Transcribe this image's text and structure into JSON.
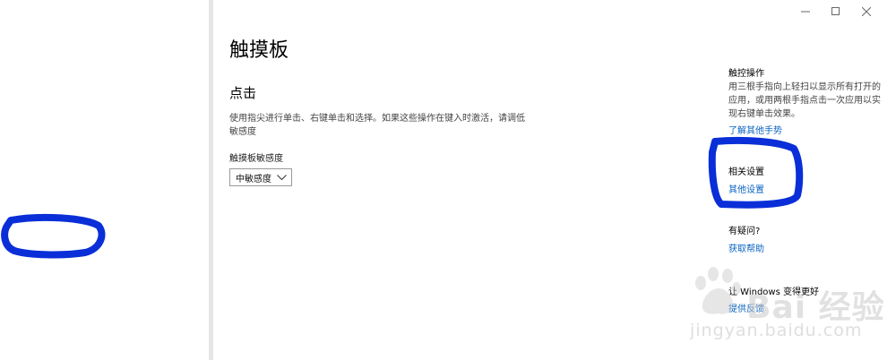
{
  "window": {
    "minimize_glyph": "—",
    "maximize_glyph": "☐",
    "close_glyph": "✕"
  },
  "page": {
    "title": "触摸板"
  },
  "tap_section": {
    "title": "点击",
    "description": "使用指尖进行单击、右键单击和选择。如果这些操作在键入时激活，请调低敏感度",
    "sensitivity_label": "触摸板敏感度",
    "sensitivity_value": "中敏感度"
  },
  "sidebar": {
    "gestures_heading": "触控操作",
    "gestures_text": "用三根手指向上轻扫以显示所有打开的应用，或用两根手指点击一次应用以实现右键单击效果。",
    "gestures_link": "了解其他手势",
    "related_heading": "相关设置",
    "related_link": "其他设置",
    "help_heading": "有疑问?",
    "help_link": "获取帮助",
    "feedback_heading": "让 Windows 变得更好",
    "feedback_link": "提供反馈"
  },
  "annotations": {
    "marker_color": "#0a2fd8"
  },
  "watermark": {
    "brand": "Bai 经验",
    "url": "jingyan.baidu.com"
  },
  "colors": {
    "link": "#0a64c2",
    "divider": "#e6e6e6"
  }
}
